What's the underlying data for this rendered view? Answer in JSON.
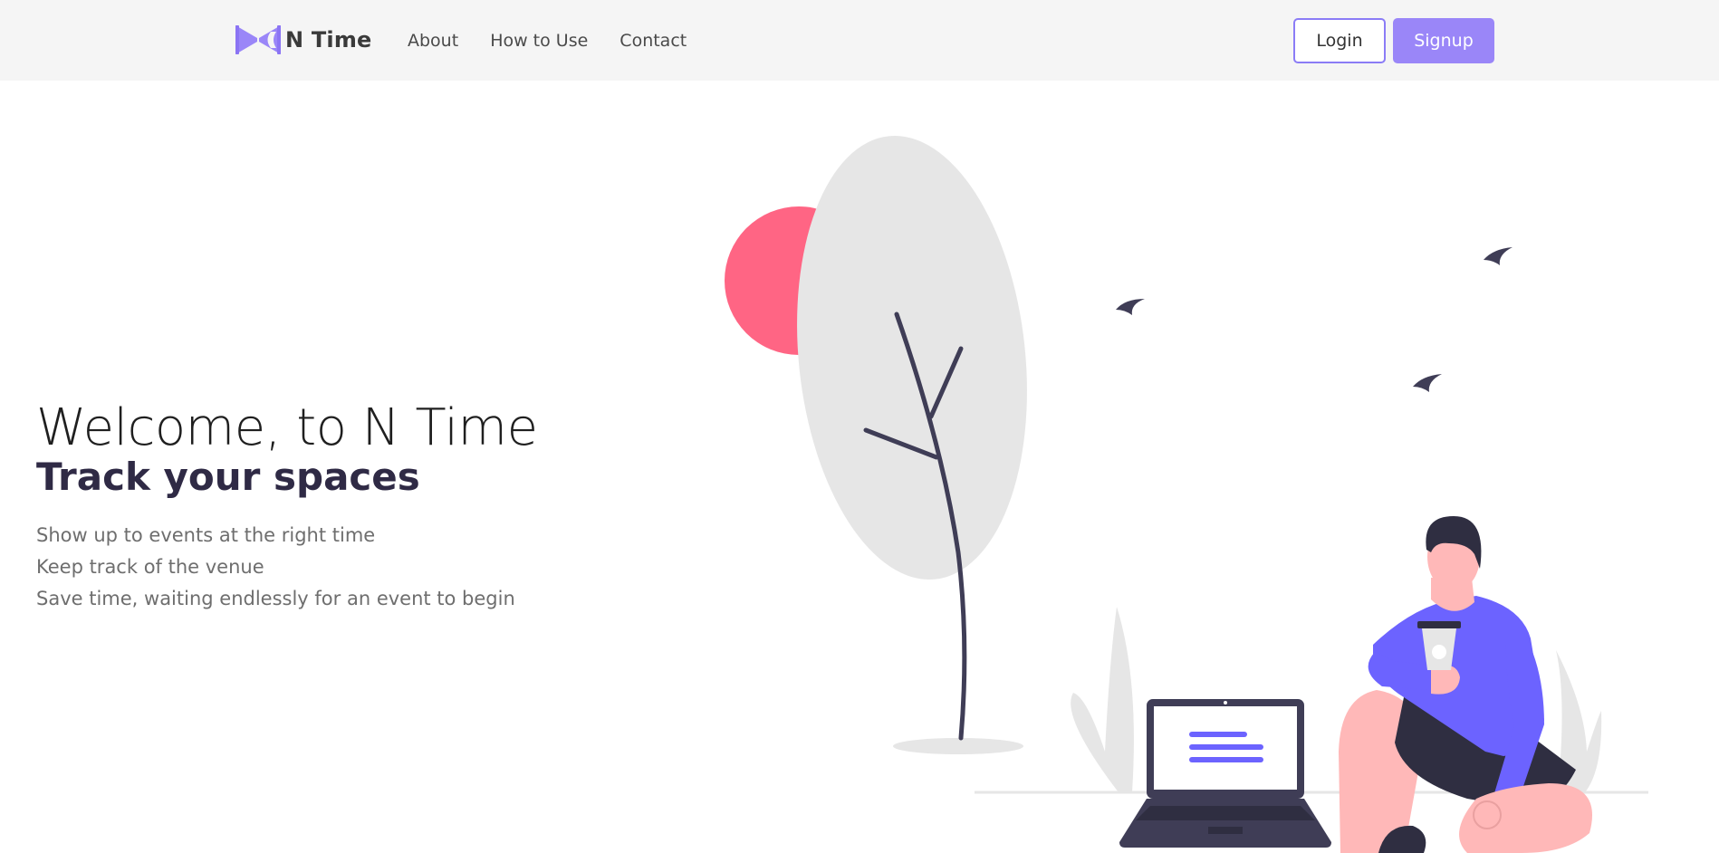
{
  "navbar": {
    "brand": "N Time",
    "links": [
      "About",
      "How to Use",
      "Contact"
    ],
    "login_label": "Login",
    "signup_label": "Signup"
  },
  "hero": {
    "welcome": "Welcome, to N Time",
    "tagline": "Track your spaces",
    "points": [
      "Show up to events at the right time",
      "Keep track of the venue",
      "Save time, waiting endlessly for an event to begin"
    ]
  },
  "colors": {
    "accent": "#9a86f8",
    "illustration_primary": "#6c63ff",
    "sun": "#ff6584",
    "dark": "#3f3d56",
    "foliage": "#e6e6e6",
    "skin": "#ffb8b8"
  },
  "icons": {
    "logo": "bowtie-logo-icon"
  }
}
